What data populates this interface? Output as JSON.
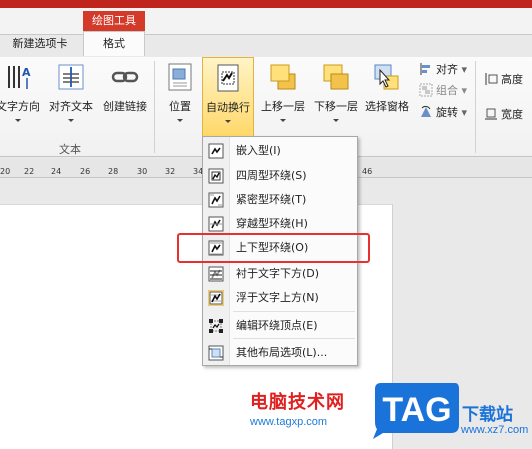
{
  "colors": {
    "accent_red": "#c0251d",
    "context_tab": "#d33a2a",
    "active_button": "#ffd86a",
    "highlight_box": "#e83030",
    "watermark_red": "#e02020",
    "watermark_blue": "#1a73d9"
  },
  "tabs": {
    "context_label": "绘图工具",
    "new_tab": "新建选项卡",
    "format": "格式"
  },
  "ribbon": {
    "text_direction": "文字方向",
    "align_text": "对齐文本",
    "create_link": "创建链接",
    "group_text": "文本",
    "position": "位置",
    "wrap_text": "自动换行",
    "bring_forward": "上移一层",
    "send_backward": "下移一层",
    "selection_pane": "选择窗格",
    "align": "对齐",
    "group": "组合",
    "rotate": "旋转",
    "height": "高度",
    "width": "宽度"
  },
  "ruler": [
    "20",
    "22",
    "24",
    "26",
    "28",
    "30",
    "32",
    "34",
    "46"
  ],
  "menu": {
    "items": [
      {
        "label": "嵌入型(I)",
        "icon": "inline-wrap-icon"
      },
      {
        "label": "四周型环绕(S)",
        "icon": "square-wrap-icon"
      },
      {
        "label": "紧密型环绕(T)",
        "icon": "tight-wrap-icon"
      },
      {
        "label": "穿越型环绕(H)",
        "icon": "through-wrap-icon"
      },
      {
        "label": "上下型环绕(O)",
        "icon": "top-bottom-wrap-icon"
      },
      {
        "label": "衬于文字下方(D)",
        "icon": "behind-text-icon"
      },
      {
        "label": "浮于文字上方(N)",
        "icon": "in-front-of-text-icon"
      },
      {
        "label": "编辑环绕顶点(E)",
        "icon": "edit-wrap-points-icon"
      },
      {
        "label": "其他布局选项(L)...",
        "icon": "more-layout-options-icon"
      }
    ]
  },
  "watermark": {
    "chinese": "电脑技术网",
    "url": "www.tagxp.com",
    "logo": "TAG",
    "site": "下载站",
    "domain": "www.xz7.com"
  }
}
